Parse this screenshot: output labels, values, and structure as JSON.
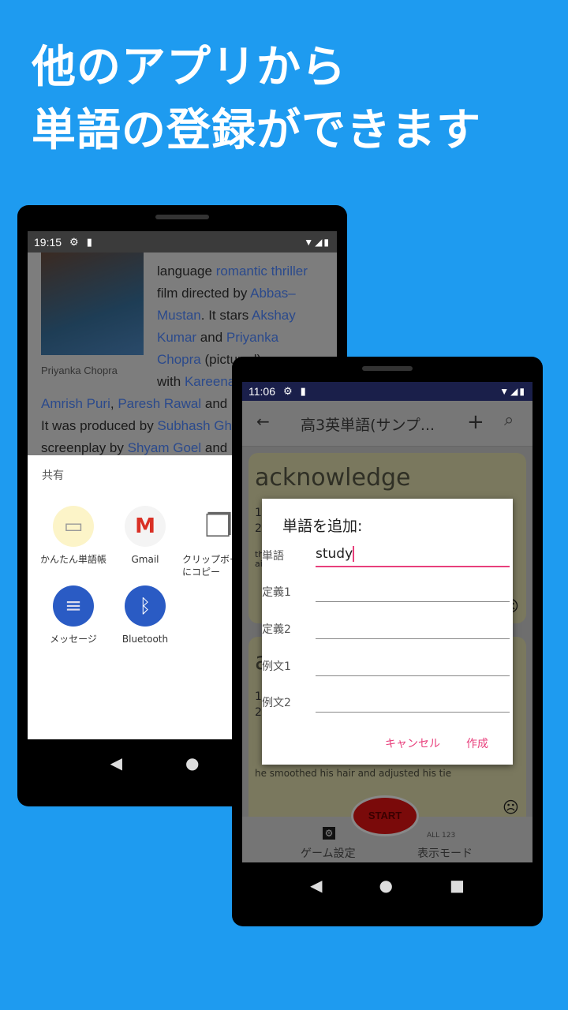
{
  "headline": {
    "line1": "他のアプリから",
    "line2": "単語の登録ができます"
  },
  "colors": {
    "background": "#1e9bf0",
    "accent": "#e8407c",
    "status_bar_app": "#1a1f4a"
  },
  "phone1": {
    "status": {
      "time": "19:15",
      "icons": [
        "gear-icon",
        "sd-card-icon",
        "wifi-icon",
        "signal-icon",
        "battery-charging-icon"
      ]
    },
    "article": {
      "caption": "Priyanka Chopra",
      "lines": [
        [
          {
            "t": "language "
          },
          {
            "t": "romantic thriller",
            "link": true
          }
        ],
        [
          {
            "t": "film directed by "
          },
          {
            "t": "Abbas–",
            "link": true
          }
        ],
        [
          {
            "t": "Mustan",
            "link": true
          },
          {
            "t": ". It stars "
          },
          {
            "t": "Akshay",
            "link": true
          }
        ],
        [
          {
            "t": "Kumar",
            "link": true
          },
          {
            "t": " and "
          },
          {
            "t": "Priyanka",
            "link": true
          }
        ],
        [
          {
            "t": "Chopra",
            "link": true
          },
          {
            "t": " (pictured)"
          }
        ],
        [
          {
            "t": "with "
          },
          {
            "t": "Kareena",
            "link": true
          }
        ]
      ],
      "full_lines": [
        [
          {
            "t": "Amrish Puri",
            "link": true
          },
          {
            "t": ", "
          },
          {
            "t": "Paresh Rawal",
            "link": true
          },
          {
            "t": " and"
          }
        ],
        [
          {
            "t": "It was produced by "
          },
          {
            "t": "Subhash Ghai",
            "link": true
          }
        ],
        [
          {
            "t": "screenplay by "
          },
          {
            "t": "Shyam Goel",
            "link": true
          },
          {
            "t": " and"
          }
        ]
      ]
    },
    "share_sheet": {
      "title": "共有",
      "items": [
        {
          "label": "かんたん単語帳",
          "icon": "flashcards-icon"
        },
        {
          "label": "Gmail",
          "icon": "gmail-icon"
        },
        {
          "label": "クリップボードにコピー",
          "icon": "copy-icon"
        },
        {
          "label": "メッセージ",
          "icon": "messages-icon"
        },
        {
          "label": "Bluetooth",
          "icon": "bluetooth-icon"
        }
      ]
    }
  },
  "phone2": {
    "status": {
      "time": "11:06"
    },
    "toolbar": {
      "title": "高3英単語(サンプ...",
      "back": "←",
      "add": "+",
      "search": "⌕"
    },
    "card1": {
      "word": "acknowledge",
      "l1": "1",
      "l2": "2",
      "ex": "th",
      "ex2": "ai"
    },
    "card2": {
      "word": "a",
      "l1": "1",
      "l2": "2",
      "example": "he smoothed his hair and adjusted his tie"
    },
    "start": "START",
    "bottom": {
      "settings": "ゲーム設定",
      "mode": "表示モード",
      "mode_small": "ALL  123"
    },
    "dialog": {
      "title": "単語を追加:",
      "fields": [
        {
          "label": "単語",
          "value": "study"
        },
        {
          "label": "定義1",
          "value": ""
        },
        {
          "label": "定義2",
          "value": ""
        },
        {
          "label": "例文1",
          "value": ""
        },
        {
          "label": "例文2",
          "value": ""
        }
      ],
      "cancel": "キャンセル",
      "create": "作成"
    }
  }
}
